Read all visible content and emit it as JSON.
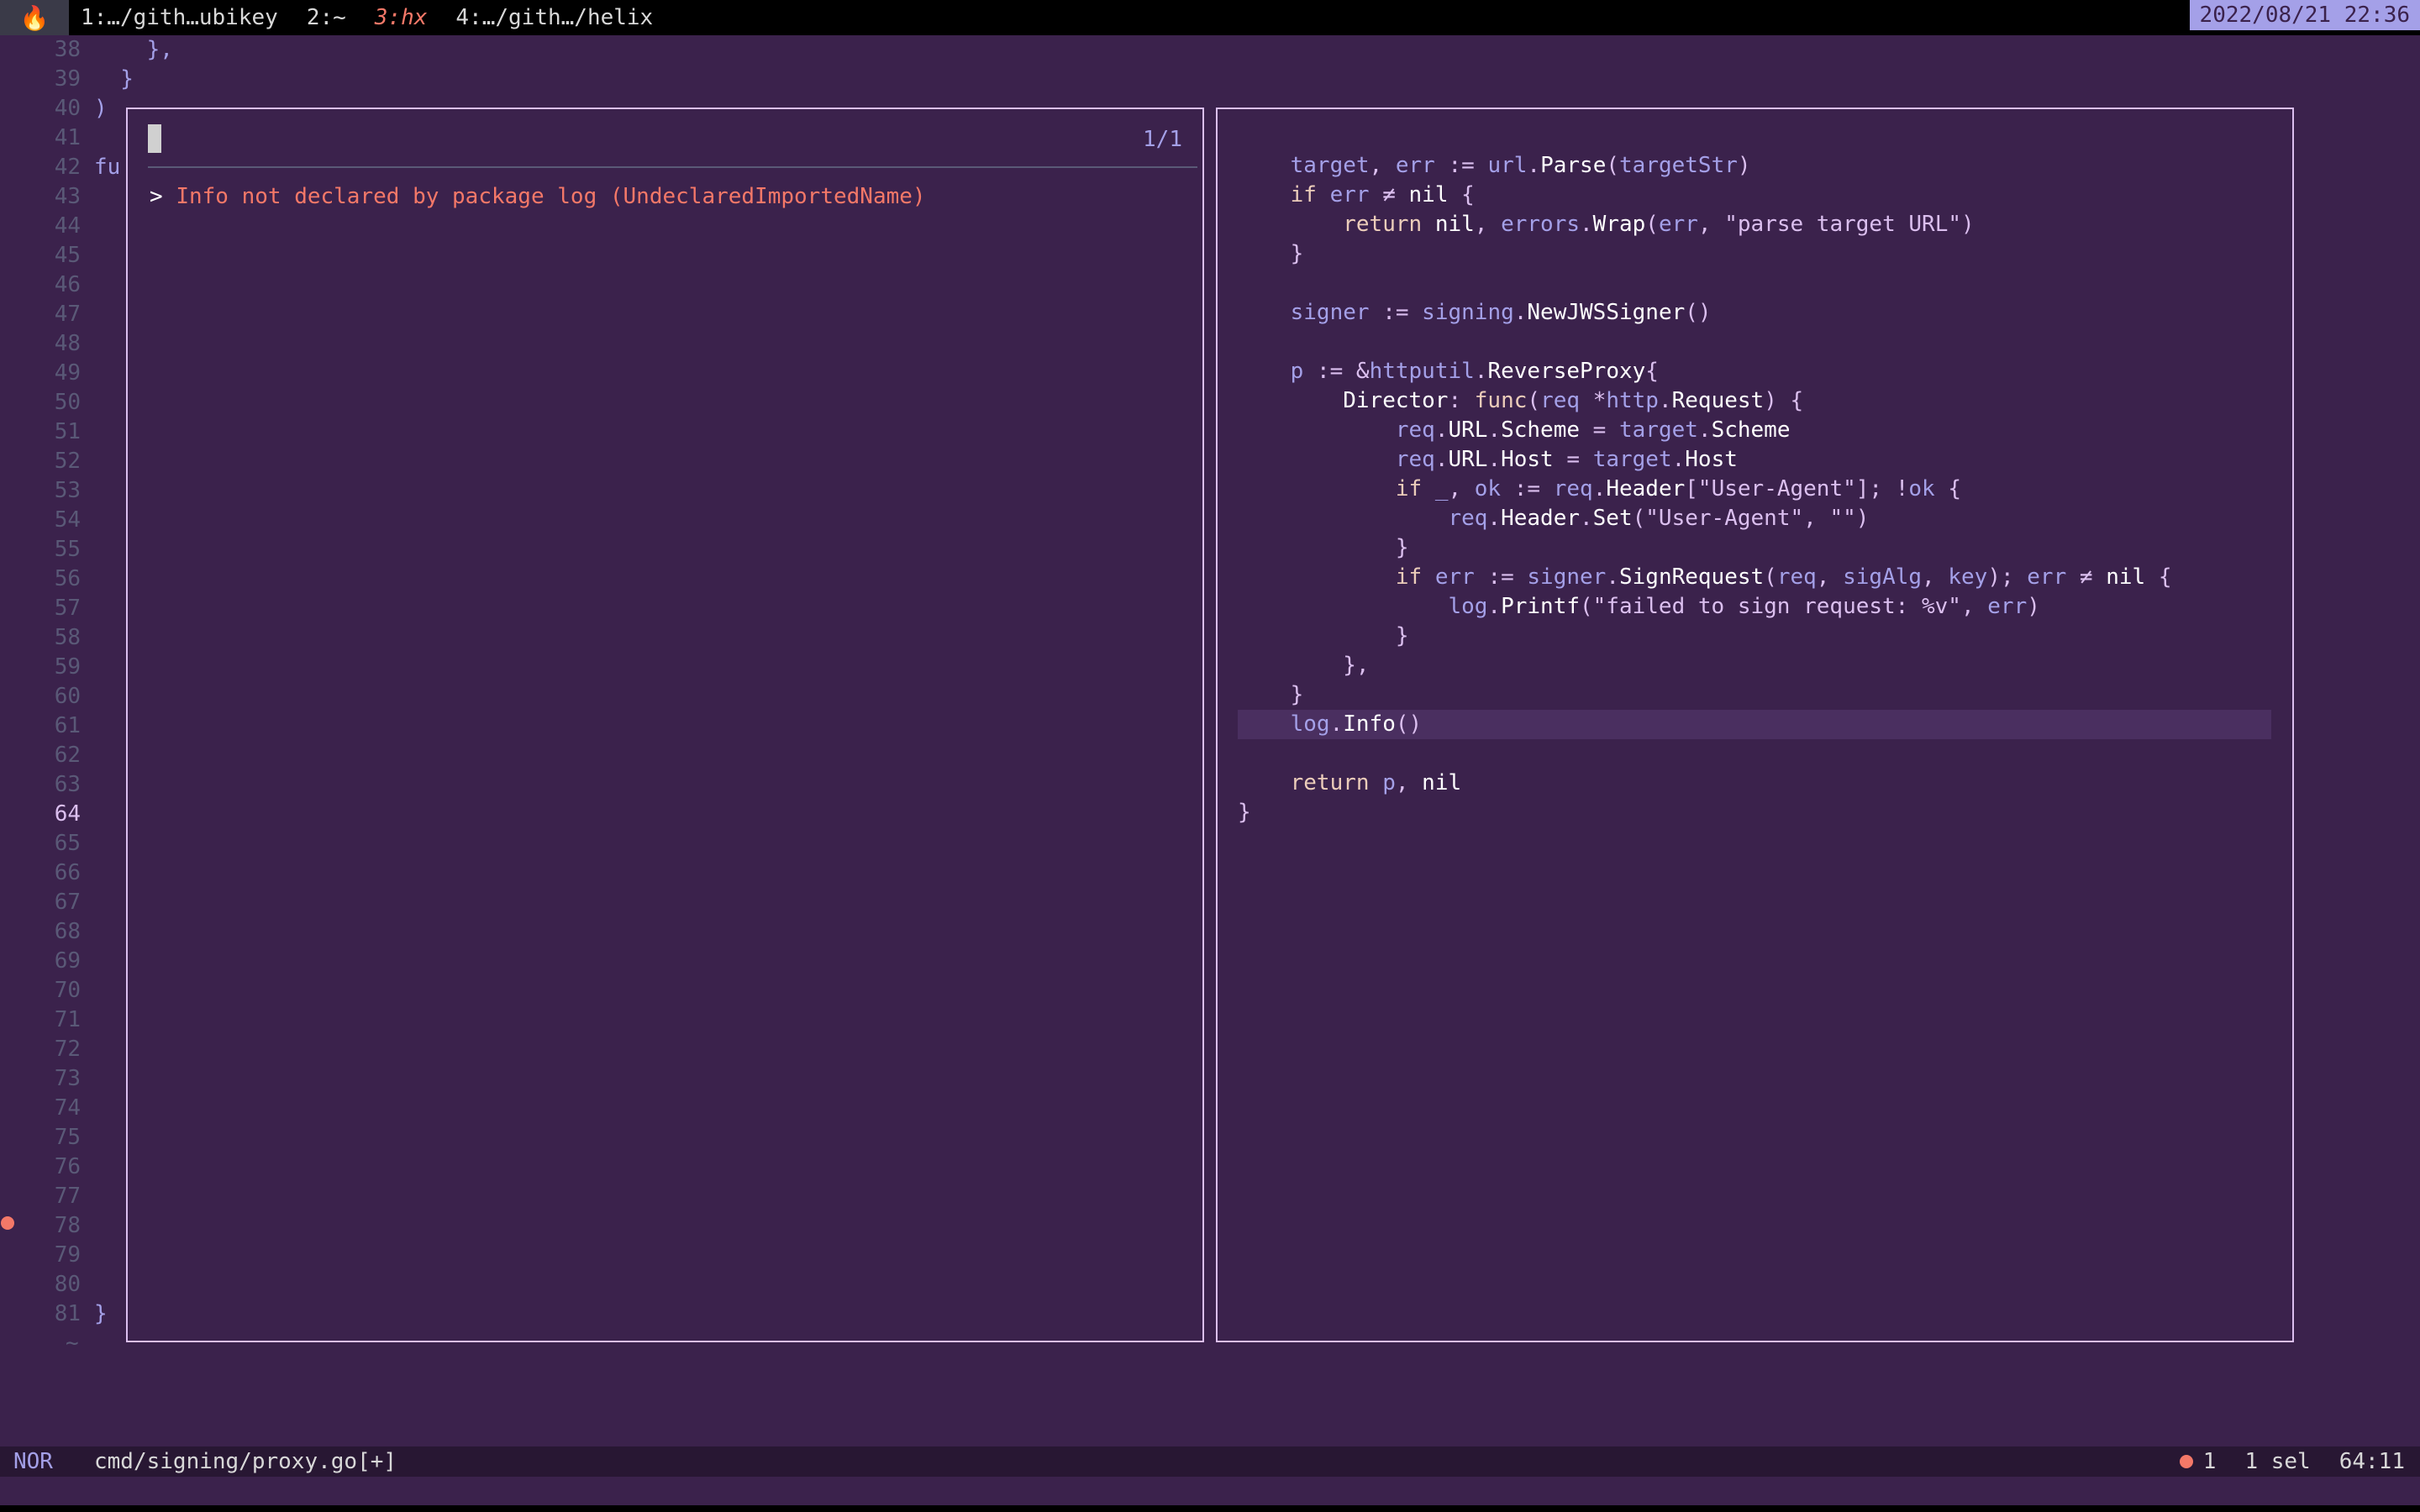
{
  "tmux": {
    "icon": "flame-icon",
    "windows": [
      {
        "label": "1:…/gith…ubikey",
        "active": false
      },
      {
        "label": "2:~",
        "active": false
      },
      {
        "label": "3:hx",
        "active": true
      },
      {
        "label": "4:…/gith…/helix",
        "active": false
      }
    ],
    "clock": "2022/08/21 22:36"
  },
  "gutter": {
    "line_numbers": [
      "38",
      "39",
      "40",
      "41",
      "42",
      "43",
      "44",
      "45",
      "46",
      "47",
      "48",
      "49",
      "50",
      "51",
      "52",
      "53",
      "54",
      "55",
      "56",
      "57",
      "58",
      "59",
      "60",
      "61",
      "62",
      "63",
      "64",
      "65",
      "66",
      "67",
      "68",
      "69",
      "70",
      "71",
      "72",
      "73",
      "74",
      "75",
      "76",
      "77",
      "78",
      "79",
      "80",
      "81"
    ],
    "current_line": "64",
    "tilde": "~"
  },
  "editor_lines": {
    "l38": "    },",
    "l39": "  }",
    "l40": ")",
    "l42": "fu",
    "l81": "}"
  },
  "picker": {
    "match_count": "1/1",
    "item_marker": "> ",
    "item_text": "Info not declared by package log (UndeclaredImportedName)"
  },
  "status": {
    "mode": "NOR",
    "file": "cmd/signing/proxy.go[+]",
    "errors": "1",
    "selections": "1 sel",
    "position": "64:11"
  },
  "colors": {
    "background": "#3b224c",
    "accent": "#a4a0e8",
    "error": "#f47868",
    "border": "#dbbfef"
  }
}
